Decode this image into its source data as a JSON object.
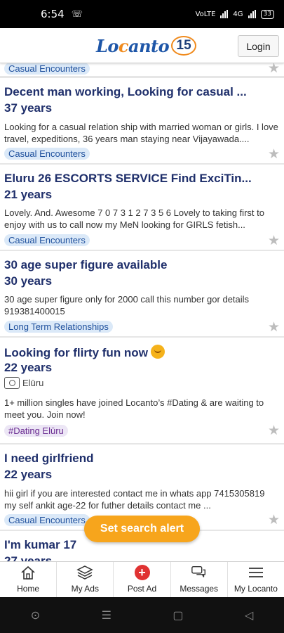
{
  "status_bar": {
    "time": "6:54",
    "network": "4G",
    "battery": "33"
  },
  "header": {
    "logo_text_a": "Lo",
    "logo_text_o": "c",
    "logo_text_b": "anto",
    "logo_badge": "15",
    "login_label": "Login"
  },
  "listings": [
    {
      "tag": "Casual Encounters"
    },
    {
      "title": "Decent man working, Looking for casual ...",
      "age": "37 years",
      "description": "Looking for a casual relation ship with married woman or girls. I love travel, expeditions, 36 years man staying near Vijayawada....",
      "tag": "Casual Encounters"
    },
    {
      "title": "Eluru 26 ESCORTS SERVICE Find ExciTin...",
      "age": "21 years",
      "description": "Lovely. And. Awesome 7 0 7 3 1 2 7 3 5 6 Lovely to taking first to enjoy with us to call now my MeN looking for GIRLS fetish...",
      "tag": "Casual Encounters"
    },
    {
      "title": "30 age super figure available",
      "age": "30 years",
      "description": "30 age super figure only for 2000 call this number gor details 919381400015",
      "tag": "Long Term Relationships"
    },
    {
      "title": "Looking for flirty fun now",
      "age": "22 years",
      "location": "Elūru",
      "description": "1+ million singles have joined Locanto’s #Dating & are waiting to meet you. Join now!",
      "tag": "#Dating Elūru"
    },
    {
      "title": "I need girlfriend",
      "age": "22 years",
      "description": "hii girl if you are interested contact me in whats app 7415305819 my self ankit age-22 for futher details contact me ...",
      "tag": "Casual Encounters"
    },
    {
      "title": "I'm kumar 17",
      "age": "27 years"
    }
  ],
  "set_search_alert_label": "Set search alert",
  "bottom_nav": [
    {
      "label": "Home",
      "icon": "home-icon"
    },
    {
      "label": "My Ads",
      "icon": "stack-icon"
    },
    {
      "label": "Post Ad",
      "icon": "plus-circle-icon"
    },
    {
      "label": "Messages",
      "icon": "chat-icon"
    },
    {
      "label": "My Locanto",
      "icon": "menu-icon"
    }
  ],
  "colors": {
    "title": "#1f2f6b",
    "tag_bg": "#dbe9f8",
    "tag_text": "#1d4f9c",
    "accent": "#f7a51c",
    "post_ad": "#e03232"
  }
}
